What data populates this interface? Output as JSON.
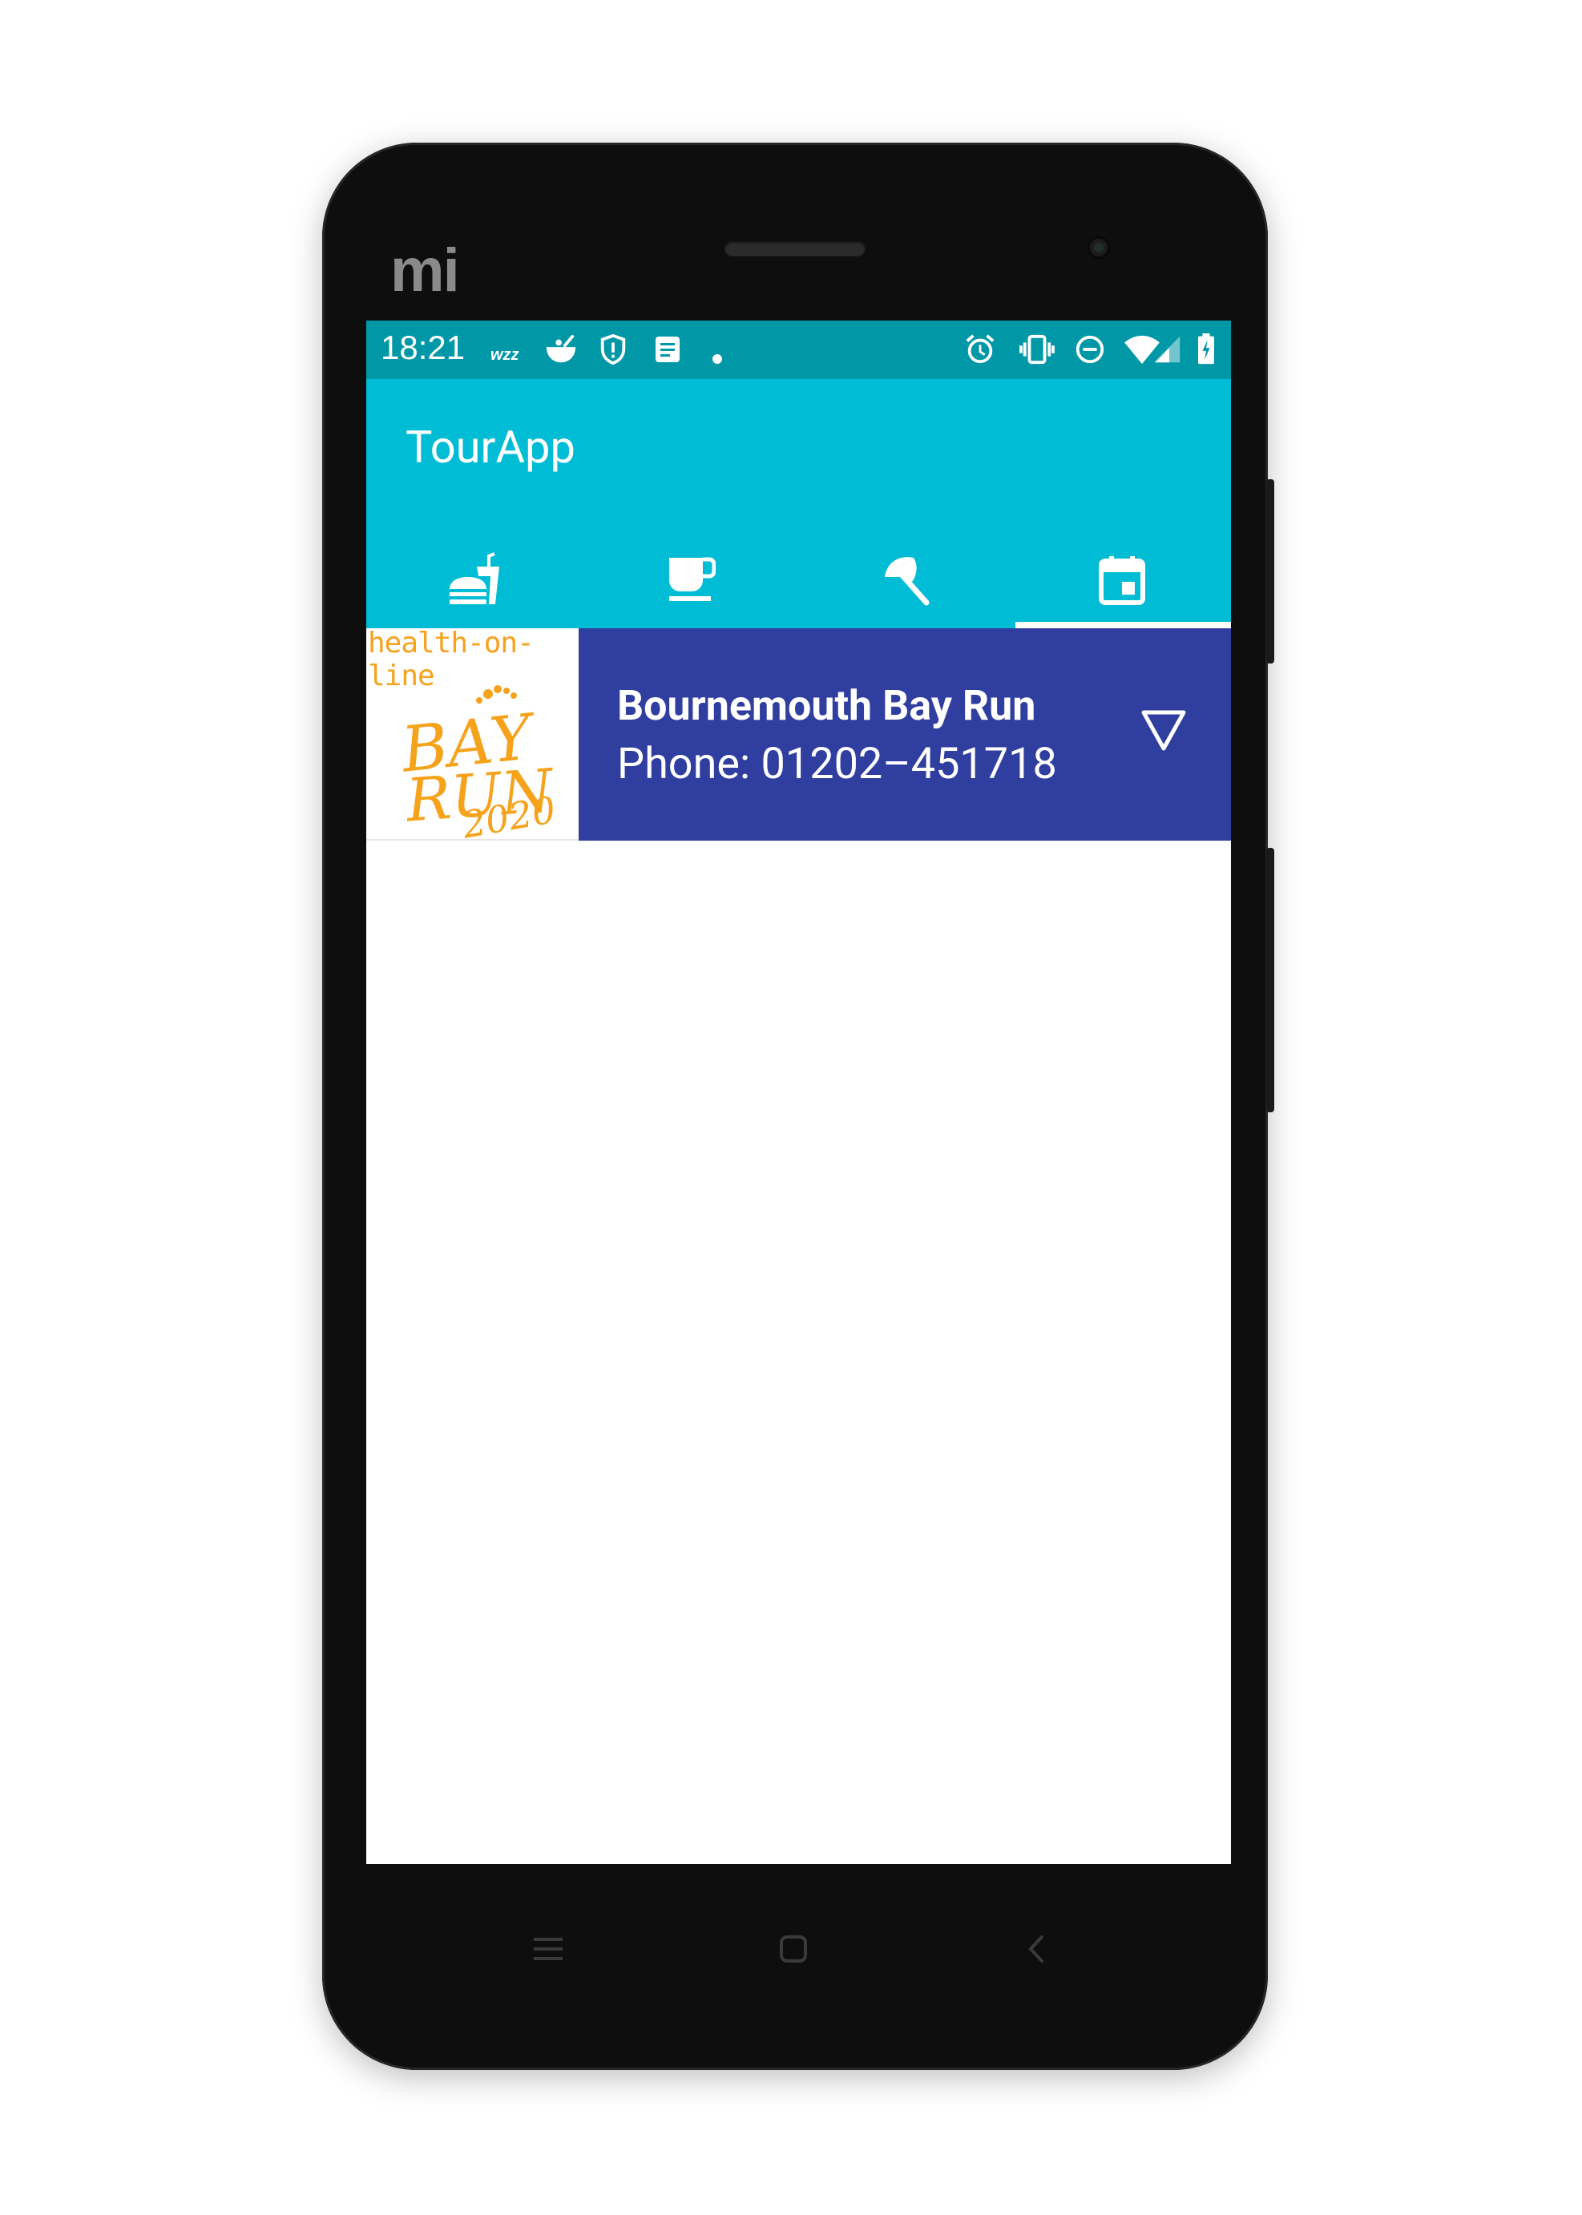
{
  "device": {
    "brand_logo": "mi"
  },
  "status_bar": {
    "time": "18:21",
    "icons": [
      "wizz-icon",
      "bowl-icon",
      "shield-alert-icon",
      "notes-icon",
      "dot-icon",
      "alarm-icon",
      "vibrate-icon",
      "dnd-icon",
      "wifi-icon",
      "signal-icon",
      "battery-charging-icon"
    ]
  },
  "app_bar": {
    "title": "TourApp"
  },
  "tabs": [
    {
      "icon": "fastfood-icon"
    },
    {
      "icon": "coffee-icon"
    },
    {
      "icon": "beach-umbrella-icon"
    },
    {
      "icon": "calendar-event-icon",
      "selected": true
    }
  ],
  "events": [
    {
      "name": "Bournemouth Bay Run",
      "phone": "Phone: 01202–451718",
      "thumbnail": {
        "header": "health-on-line",
        "line1": "BAY",
        "line2": "RUN",
        "year": "2020"
      }
    }
  ],
  "nav_bar": {
    "keys": [
      "menu-icon",
      "home-icon",
      "back-icon"
    ]
  },
  "colors": {
    "status_bar": "#0097a7",
    "app_bar": "#00bcd4",
    "card": "#303f9f",
    "thumb_text": "#f6a21b"
  }
}
